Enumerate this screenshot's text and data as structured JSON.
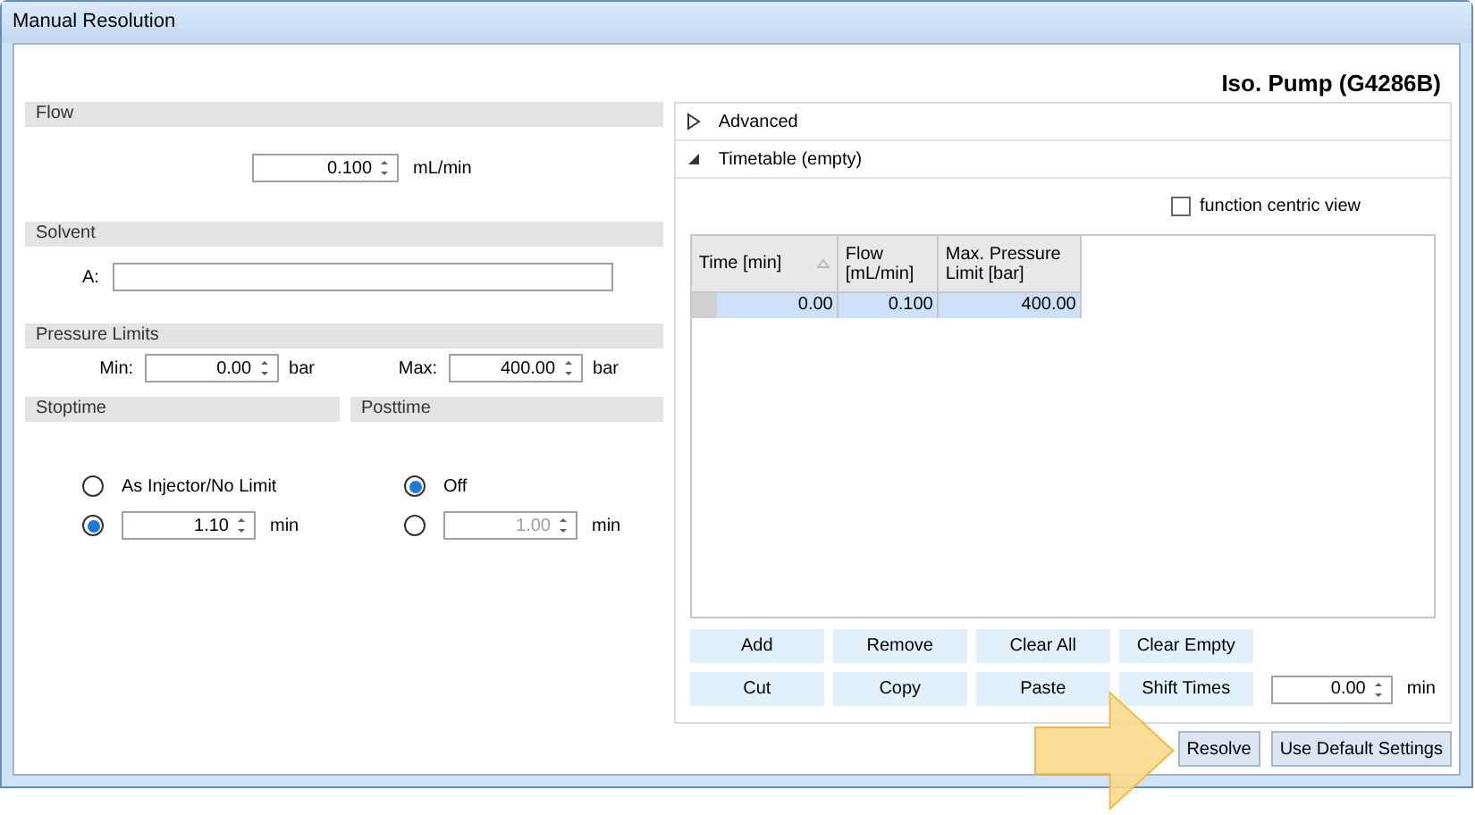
{
  "window": {
    "title": "Manual Resolution"
  },
  "device_title": "Iso. Pump (G4286B)",
  "flow": {
    "header": "Flow",
    "value": "0.100",
    "unit": "mL/min"
  },
  "solvent": {
    "header": "Solvent",
    "label": "A:"
  },
  "pressure_limits": {
    "header": "Pressure Limits",
    "fields": [
      {
        "label": "Min:",
        "value": "0.00",
        "unit": "bar"
      },
      {
        "label": "Max:",
        "value": "400.00",
        "unit": "bar"
      }
    ]
  },
  "stoptime": {
    "header": "Stoptime",
    "options": [
      {
        "kind": "label",
        "label": "As Injector/No Limit",
        "selected": false
      },
      {
        "kind": "field",
        "value": "1.10",
        "unit": "min",
        "selected": true,
        "disabled": false
      }
    ]
  },
  "posttime": {
    "header": "Posttime",
    "options": [
      {
        "kind": "label",
        "label": "Off",
        "selected": true
      },
      {
        "kind": "field",
        "value": "1.00",
        "unit": "min",
        "selected": false,
        "disabled": true
      }
    ]
  },
  "sections": [
    {
      "label": "Advanced",
      "expanded": false
    },
    {
      "label": "Timetable (empty)",
      "expanded": true
    }
  ],
  "function_centric_view": {
    "label": "function centric view",
    "checked": false
  },
  "table": {
    "columns": [
      "Time [min]",
      "Flow [mL/min]",
      "Max. Pressure Limit [bar]"
    ],
    "rows": [
      {
        "cells": [
          "0.00",
          "0.100",
          "400.00"
        ],
        "selected": true
      }
    ]
  },
  "table_buttons": [
    [
      "Add",
      "Remove",
      "Clear All",
      "Clear Empty"
    ],
    [
      "Cut",
      "Copy",
      "Paste",
      "Shift Times"
    ]
  ],
  "shift": {
    "value": "0.00",
    "unit": "min"
  },
  "footer_buttons": [
    "Resolve",
    "Use Default Settings"
  ]
}
